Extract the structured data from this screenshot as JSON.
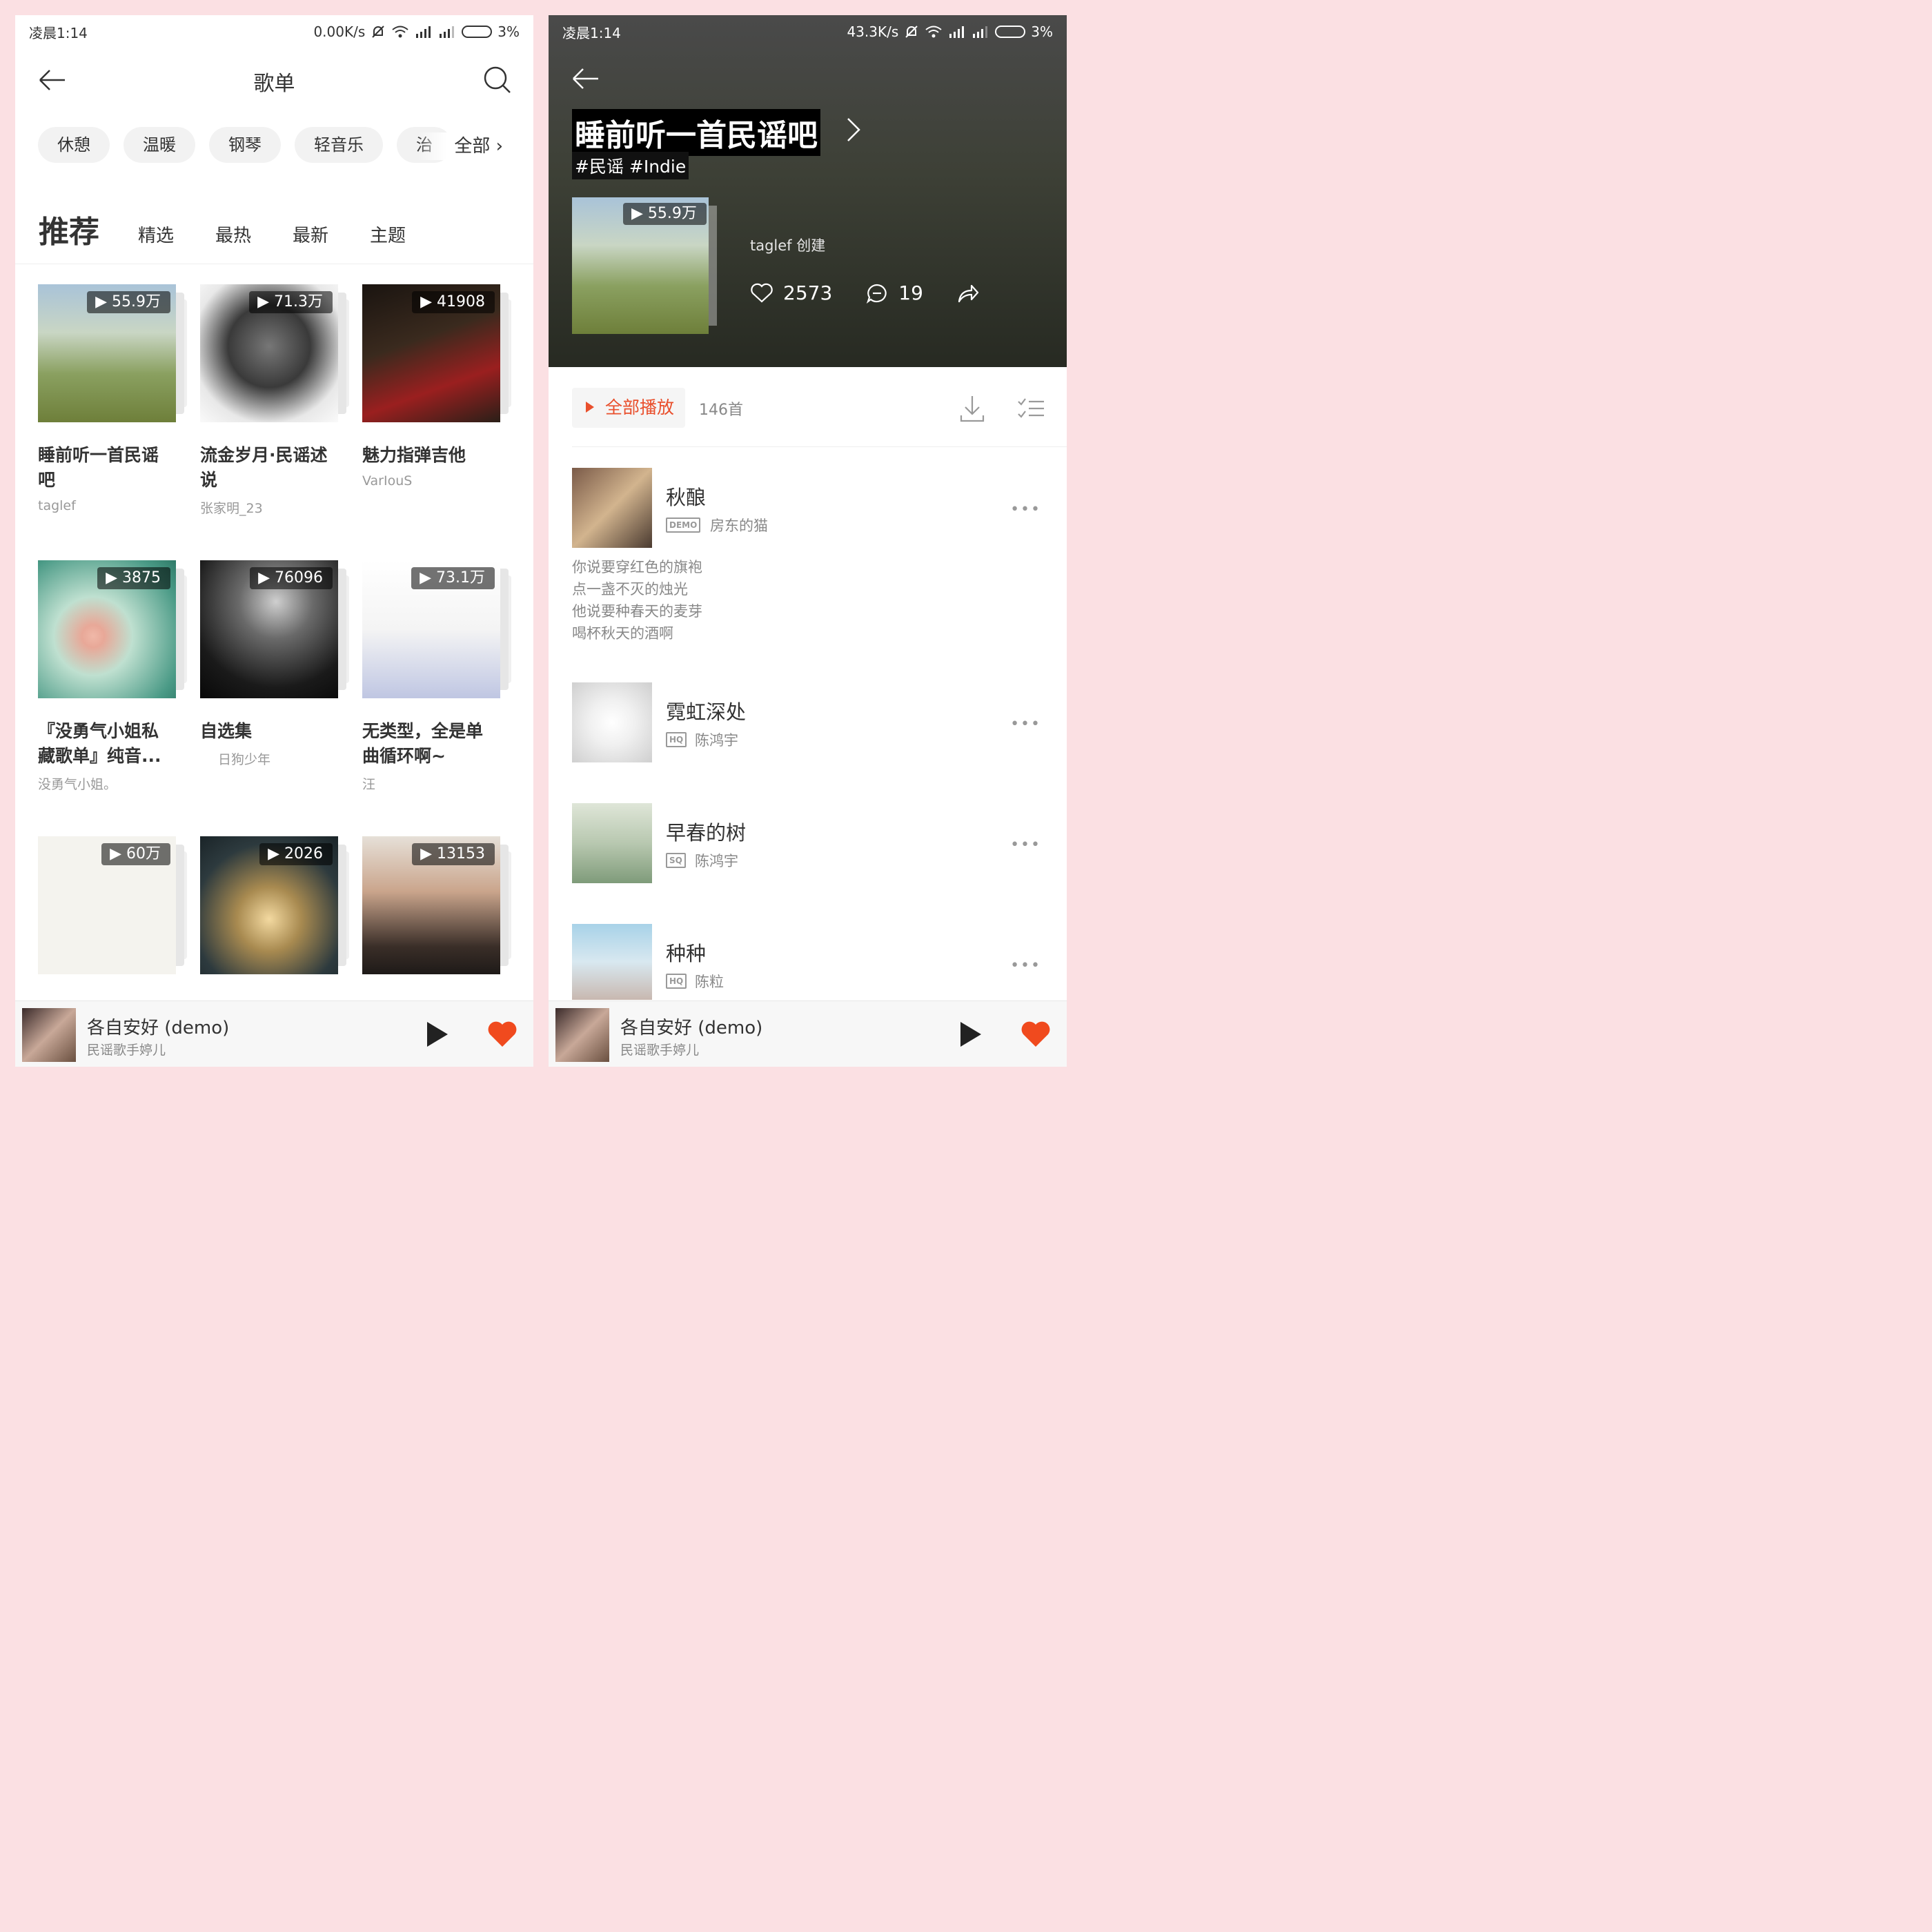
{
  "left": {
    "status": {
      "time": "凌晨1:14",
      "speed": "0.00K/s",
      "battery": "3%"
    },
    "header": {
      "title": "歌单"
    },
    "chips": [
      "休憩",
      "温暖",
      "钢琴",
      "轻音乐",
      "治"
    ],
    "chip_all": "全部",
    "tabs": {
      "active": "推荐",
      "items": [
        "精选",
        "最热",
        "最新",
        "主题"
      ]
    },
    "playlists": [
      {
        "title": "睡前听一首民谣吧",
        "author": "taglef",
        "plays": "55.9万"
      },
      {
        "title": "流金岁月·民谣述说",
        "author": "张家明_23",
        "plays": "71.3万"
      },
      {
        "title": "魅力指弹吉他",
        "author": "VarIouS",
        "plays": "41908"
      },
      {
        "title": "『没勇气小姐私藏歌单』纯音...",
        "author": "没勇气小姐。",
        "plays": "3875"
      },
      {
        "title": "自选集",
        "author": "日狗少年",
        "plays": "76096"
      },
      {
        "title": "无类型，全是单曲循环啊~",
        "author": "汪",
        "plays": "73.1万"
      },
      {
        "title": "",
        "author": "",
        "plays": "60万"
      },
      {
        "title": "",
        "author": "",
        "plays": "2026"
      },
      {
        "title": "",
        "author": "",
        "plays": "13153"
      }
    ],
    "player": {
      "song": "各自安好 (demo)",
      "artist": "民谣歌手婷儿"
    }
  },
  "right": {
    "status": {
      "time": "凌晨1:14",
      "speed": "43.3K/s",
      "battery": "3%"
    },
    "playlist": {
      "title": "睡前听一首民谣吧",
      "tags": "#民谣 #Indie",
      "plays": "55.9万",
      "creator": "taglef 创建",
      "likes": "2573",
      "comments": "19"
    },
    "actions": {
      "play_all": "全部播放",
      "count": "146首"
    },
    "songs": [
      {
        "name": "秋酿",
        "quality": "DEMO",
        "artist": "房东的猫",
        "lyrics": [
          "你说要穿红色的旗袍",
          "点一盏不灭的烛光",
          "他说要种春天的麦芽",
          "喝杯秋天的酒啊"
        ]
      },
      {
        "name": "霓虹深处",
        "quality": "HQ",
        "artist": "陈鸿宇"
      },
      {
        "name": "早春的树",
        "quality": "SQ",
        "artist": "陈鸿宇"
      },
      {
        "name": "种种",
        "quality": "HQ",
        "artist": "陈粒"
      }
    ],
    "player": {
      "song": "各自安好 (demo)",
      "artist": "民谣歌手婷儿"
    }
  },
  "colors": {
    "accent": "#e94f2c",
    "background": "#fbe0e3"
  },
  "icons": [
    "back-arrow-icon",
    "search-icon",
    "chevron-right-icon",
    "play-icon",
    "heart-icon",
    "comment-icon",
    "share-icon",
    "download-icon",
    "multi-select-icon",
    "wifi-icon",
    "signal-icon",
    "mute-icon"
  ]
}
